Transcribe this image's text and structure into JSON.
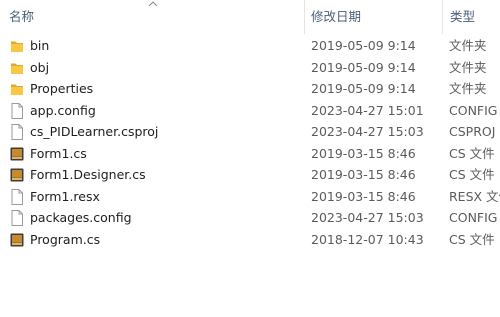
{
  "columns": {
    "name": "名称",
    "date": "修改日期",
    "type": "类型"
  },
  "colors": {
    "folder": "#f8c743",
    "folder_dark": "#e0a82e",
    "header_text": "#4c607a"
  },
  "files": [
    {
      "name": "bin",
      "date": "2019-05-09 9:14",
      "type": "文件夹",
      "icon": "folder"
    },
    {
      "name": "obj",
      "date": "2019-05-09 9:14",
      "type": "文件夹",
      "icon": "folder"
    },
    {
      "name": "Properties",
      "date": "2019-05-09 9:14",
      "type": "文件夹",
      "icon": "folder"
    },
    {
      "name": "app.config",
      "date": "2023-04-27 15:01",
      "type": "CONFIG",
      "icon": "document"
    },
    {
      "name": "cs_PIDLearner.csproj",
      "date": "2023-04-27 15:03",
      "type": "CSPROJ",
      "icon": "document"
    },
    {
      "name": "Form1.cs",
      "date": "2019-03-15 8:46",
      "type": "CS 文件",
      "icon": "cs-file"
    },
    {
      "name": "Form1.Designer.cs",
      "date": "2019-03-15 8:46",
      "type": "CS 文件",
      "icon": "cs-file"
    },
    {
      "name": "Form1.resx",
      "date": "2019-03-15 8:46",
      "type": "RESX 文件",
      "icon": "document"
    },
    {
      "name": "packages.config",
      "date": "2023-04-27 15:03",
      "type": "CONFIG",
      "icon": "document"
    },
    {
      "name": "Program.cs",
      "date": "2018-12-07 10:43",
      "type": "CS 文件",
      "icon": "cs-file"
    }
  ]
}
